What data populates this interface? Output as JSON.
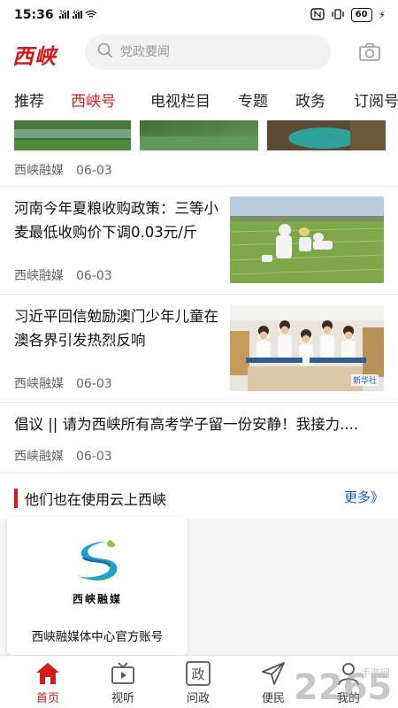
{
  "status_bar": {
    "time": "15:36",
    "signal_text": "3G 4G",
    "battery": "60"
  },
  "header": {
    "logo": "西峡",
    "search_placeholder": "党政要闻"
  },
  "tabs": [
    {
      "label": "推荐",
      "active": false
    },
    {
      "label": "西峡号",
      "active": true
    },
    {
      "label": "电视栏目",
      "active": false
    },
    {
      "label": "专题",
      "active": false
    },
    {
      "label": "政务",
      "active": false
    },
    {
      "label": "订阅号",
      "active": false
    }
  ],
  "feed": {
    "item0": {
      "source": "西峡融媒",
      "date": "06-03"
    },
    "item1": {
      "title": "河南今年夏粮收购政策：三等小麦最低收购价下调0.03元/斤",
      "source": "西峡融媒",
      "date": "06-03"
    },
    "item2": {
      "title": "习近平回信勉励澳门少年儿童在澳各界引发热烈反响",
      "source": "西峡融媒",
      "date": "06-03",
      "thumb_badge": "新华社"
    },
    "item3": {
      "title": "倡议 || 请为西峡所有高考学子留一份安静！我接力....",
      "source": "西峡融媒",
      "date": "06-03"
    }
  },
  "section": {
    "title": "他们也在使用云上西峡",
    "more": "更多》",
    "card": {
      "logo_text": "西峡融媒",
      "name": "西峡融媒体中心官方账号"
    }
  },
  "bottom_nav": [
    {
      "label": "首页",
      "icon": "home-icon",
      "active": true
    },
    {
      "label": "视听",
      "icon": "tv-icon",
      "active": false
    },
    {
      "label": "问政",
      "icon": "zheng-icon",
      "active": false
    },
    {
      "label": "便民",
      "icon": "send-icon",
      "active": false
    },
    {
      "label": "我的",
      "icon": "person-icon",
      "active": false
    }
  ],
  "watermark": "2265 手游网",
  "colors": {
    "accent": "#d21b1b",
    "link": "#1a5bd0"
  }
}
